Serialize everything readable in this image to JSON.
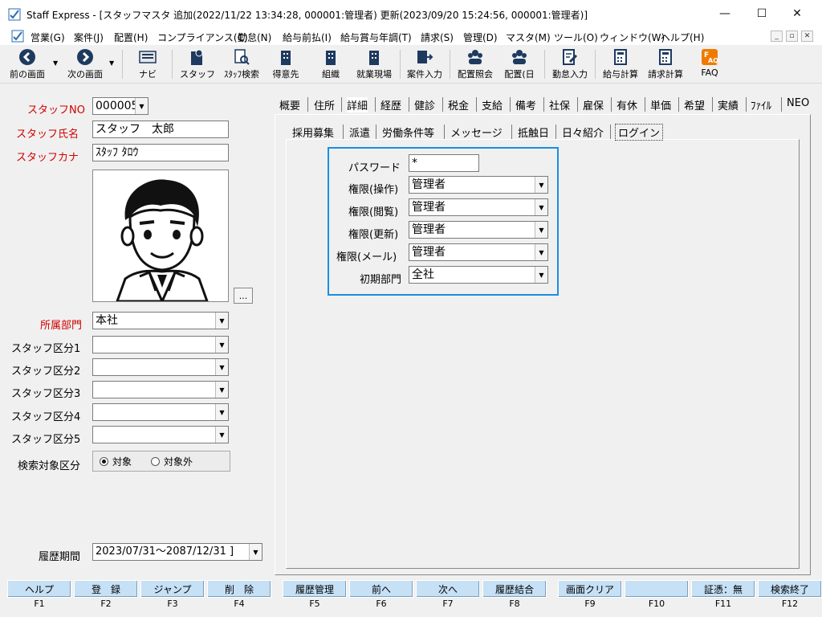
{
  "window": {
    "title": "Staff Express - [スタッフマスタ 追加(2022/11/22 13:34:28, 000001:管理者) 更新(2023/09/20 15:24:56, 000001:管理者)]",
    "minimize": "—",
    "maximize": "☐",
    "close": "✕"
  },
  "menu": [
    "営業(G)",
    "案件(J)",
    "配置(H)",
    "コンプライアンス(C)",
    "勤怠(N)",
    "給与前払(I)",
    "給与賞与年調(T)",
    "請求(S)",
    "管理(D)",
    "マスタ(M)",
    "ツール(O)",
    "ウィンドウ(W)",
    "ヘルプ(H)"
  ],
  "toolbar": {
    "prev": "前の画面",
    "next": "次の画面",
    "navi": "ナビ",
    "staff": "スタッフ",
    "staff_search": "ｽﾀｯﾌ検索",
    "client": "得意先",
    "org": "組織",
    "site": "就業現場",
    "case_input": "案件入力",
    "assign_ref": "配置照会",
    "assign_day": "配置(日",
    "attendance": "勤怠入力",
    "payroll": "給与計算",
    "billing": "請求計算",
    "faq": "FAQ"
  },
  "left": {
    "staff_no_label": "スタッフNO",
    "staff_no_value": "000005",
    "name_label": "スタッフ氏名",
    "name_value": "スタッフ　太郎",
    "kana_label": "スタッフカナ",
    "kana_value": "ｽﾀｯﾌ ﾀﾛｳ",
    "photo_btn": "...",
    "dept_label": "所属部門",
    "dept_value": "本社",
    "cat1_label": "スタッフ区分1",
    "cat2_label": "スタッフ区分2",
    "cat3_label": "スタッフ区分3",
    "cat4_label": "スタッフ区分4",
    "cat5_label": "スタッフ区分5",
    "search_label": "検索対象区分",
    "opt_target": "対象",
    "opt_nontarget": "対象外",
    "search_selected": "対象",
    "history_label": "履歴期間",
    "history_value": "2023/07/31～2087/12/31 ]"
  },
  "tabs_main": [
    "概要",
    "住所",
    "詳細",
    "経歴",
    "健診",
    "税金",
    "支給",
    "備考",
    "社保",
    "雇保",
    "有休",
    "単価",
    "希望",
    "実績",
    "ﾌｧｲﾙ",
    "NEO"
  ],
  "tabs_main_active": "詳細",
  "tabs_sub": [
    "採用募集",
    "派遣",
    "労働条件等",
    "メッセージ",
    "抵触日",
    "日々紹介",
    "ログイン"
  ],
  "tabs_sub_active": "ログイン",
  "login": {
    "password_label": "パスワード",
    "password_value": "*",
    "perm_op_label": "権限(操作)",
    "perm_op_value": "管理者",
    "perm_view_label": "権限(閲覧)",
    "perm_view_value": "管理者",
    "perm_update_label": "権限(更新)",
    "perm_update_value": "管理者",
    "perm_mail_label": "権限(メール)",
    "perm_mail_value": "管理者",
    "init_dept_label": "初期部門",
    "init_dept_value": "全社"
  },
  "fkeys": [
    {
      "label": "ヘルプ",
      "key": "F1"
    },
    {
      "label": "登　録",
      "key": "F2"
    },
    {
      "label": "ジャンプ",
      "key": "F3"
    },
    {
      "label": "削　除",
      "key": "F4"
    },
    {
      "label": "履歴管理",
      "key": "F5"
    },
    {
      "label": "前へ",
      "key": "F6"
    },
    {
      "label": "次へ",
      "key": "F7"
    },
    {
      "label": "履歴結合",
      "key": "F8"
    },
    {
      "label": "画面クリア",
      "key": "F9"
    },
    {
      "label": "",
      "key": "F10"
    },
    {
      "label": "証憑：無",
      "key": "F11"
    },
    {
      "label": "検索終了",
      "key": "F12"
    }
  ],
  "colors": {
    "required_label": "#d00000",
    "accent_border": "#1a8fe0",
    "fkey_bg": "#c6e0f5"
  }
}
